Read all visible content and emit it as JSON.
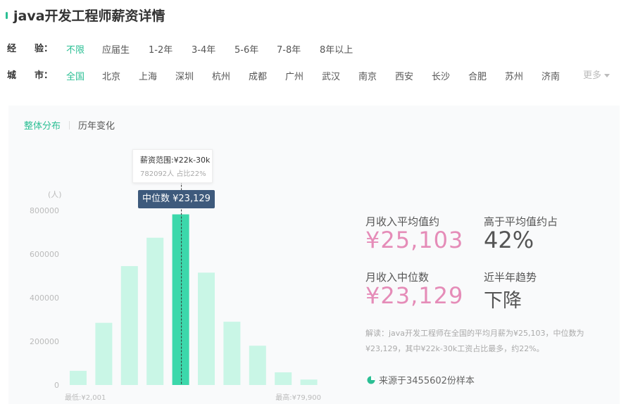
{
  "header": {
    "title": "java开发工程师薪资详情"
  },
  "filters": {
    "experience": {
      "label": "经　　验：",
      "options": [
        "不限",
        "应届生",
        "1-2年",
        "3-4年",
        "5-6年",
        "7-8年",
        "8年以上"
      ],
      "selected": "不限"
    },
    "city": {
      "label": "城　　市：",
      "options": [
        "全国",
        "北京",
        "上海",
        "深圳",
        "杭州",
        "成都",
        "广州",
        "武汉",
        "南京",
        "西安",
        "长沙",
        "合肥",
        "苏州",
        "济南"
      ],
      "selected": "全国",
      "more_label": "更多"
    }
  },
  "tabs": [
    "整体分布",
    "历年变化"
  ],
  "active_tab": "整体分布",
  "tooltip": {
    "range": "薪资范围:¥22k-30k",
    "detail": "782092人  占比22%"
  },
  "median_badge": "中位数 ¥23,129",
  "stats": {
    "avg_label": "月收入平均值约",
    "avg_value": "¥25,103",
    "above_label": "高于平均值约占",
    "above_value": "42%",
    "median_label": "月收入中位数",
    "median_value": "¥23,129",
    "trend_label": "近半年趋势",
    "trend_value": "下降"
  },
  "description": "解读：java开发工程师在全国的平均月薪为¥25,103，中位数为¥23,129，其中¥22k-30k工资占比最多，约22%。",
  "source": "来源于3455602份样本",
  "colors": {
    "accent": "#2bbf94",
    "bar": "#c9f6e6",
    "bar_highlight": "#3cd8ab",
    "pink": "#e58cb8",
    "badge": "#3e5a7c"
  },
  "chart_data": {
    "type": "bar",
    "ylabel": "(人)",
    "ylim": [
      0,
      800000
    ],
    "yticks": [
      "0",
      "200000",
      "400000",
      "600000",
      "800000"
    ],
    "x_min_label": "最低:¥2,001",
    "x_max_label": "最高:¥79,900",
    "values": [
      65000,
      285000,
      545000,
      675000,
      782092,
      515000,
      290000,
      180000,
      58000,
      25000
    ],
    "highlight_index": 4
  }
}
